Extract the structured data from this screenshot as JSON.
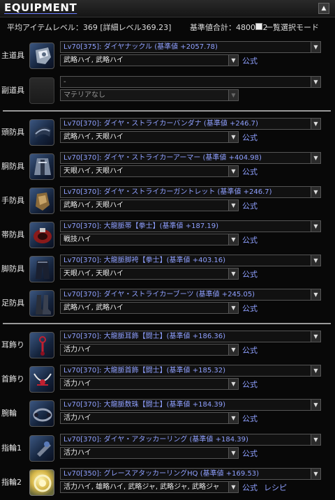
{
  "header": {
    "title": "EQUIPMENT",
    "collapse_icon": "▲",
    "avg_level": "平均アイテムレベル：369 [詳細レベル369.23]",
    "total": "基準値合計：4800.02",
    "mode_label": "一覧選択モード"
  },
  "slots": [
    {
      "label": "主道具",
      "item": "Lv70[375]: ダイヤナックル (基準値 +2057.78)",
      "materia": "武略ハイ, 武略ハイ",
      "link": "公式",
      "icon": "knuckle-icon"
    },
    {
      "label": "副道具",
      "item": "-",
      "materia": "マテリアなし",
      "link": "",
      "icon": "empty-slot-icon"
    },
    {
      "label": "頭防具",
      "item": "Lv70[370]: ダイヤ・ストライカーバンダナ (基準値 +246.7)",
      "materia": "武略ハイ, 天眼ハイ",
      "link": "公式",
      "icon": "bandana-icon"
    },
    {
      "label": "胴防具",
      "item": "Lv70[370]: ダイヤ・ストライカーアーマー (基準値 +404.98)",
      "materia": "天眼ハイ, 天眼ハイ",
      "link": "公式",
      "icon": "armor-icon"
    },
    {
      "label": "手防具",
      "item": "Lv70[370]: ダイヤ・ストライカーガントレット (基準値 +246.7)",
      "materia": "武略ハイ, 天眼ハイ",
      "link": "公式",
      "icon": "gauntlet-icon"
    },
    {
      "label": "帯防具",
      "item": "Lv70[370]: 大龍脈帯【拳士】(基準値 +187.19)",
      "materia": "戦技ハイ",
      "link": "公式",
      "icon": "belt-icon"
    },
    {
      "label": "脚防具",
      "item": "Lv70[370]: 大龍脈脚袴【拳士】(基準値 +403.16)",
      "materia": "天眼ハイ, 天眼ハイ",
      "link": "公式",
      "icon": "pants-icon"
    },
    {
      "label": "足防具",
      "item": "Lv70[370]: ダイヤ・ストライカーブーツ (基準値 +245.05)",
      "materia": "武略ハイ, 武略ハイ",
      "link": "公式",
      "icon": "boots-icon"
    },
    {
      "label": "耳飾り",
      "item": "Lv70[370]: 大龍脈耳飾【闘士】(基準値 +186.36)",
      "materia": "活力ハイ",
      "link": "公式",
      "icon": "earring-icon"
    },
    {
      "label": "首飾り",
      "item": "Lv70[370]: 大龍脈首飾【闘士】(基準値 +185.32)",
      "materia": "活力ハイ",
      "link": "公式",
      "icon": "necklace-icon"
    },
    {
      "label": "腕輪",
      "item": "Lv70[370]: 大龍脈数珠【闘士】(基準値 +184.39)",
      "materia": "活力ハイ",
      "link": "公式",
      "icon": "bracelet-icon"
    },
    {
      "label": "指輪1",
      "item": "Lv70[370]: ダイヤ・アタッカーリング (基準値 +184.39)",
      "materia": "活力ハイ",
      "link": "公式",
      "icon": "ring-icon"
    },
    {
      "label": "指輪2",
      "item": "Lv70[350]: グレースアタッカーリングHQ (基準値 +169.53)",
      "materia": "活力ハイ, 雄略ハイ, 武略ジャ, 武略ジャ, 武略ジャ",
      "link": "公式",
      "link2": "レシピ",
      "icon": "hq-ring-icon"
    }
  ],
  "dropdown_arrow": "▼"
}
